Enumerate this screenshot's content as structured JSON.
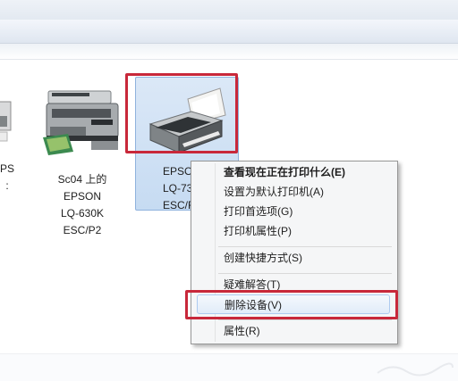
{
  "devices": [
    {
      "lines": [
        "PS",
        ":"
      ]
    },
    {
      "lines": [
        "Sc04 上的",
        "EPSON",
        "LQ-630K",
        "ESC/P2"
      ]
    },
    {
      "lines": [
        "EPSO",
        "LQ-73",
        "ESC/F"
      ]
    }
  ],
  "context_menu": {
    "items": [
      {
        "label": "查看现在正在打印什么(E)",
        "bold": true
      },
      {
        "label": "设置为默认打印机(A)"
      },
      {
        "label": "打印首选项(G)"
      },
      {
        "label": "打印机属性(P)"
      },
      {
        "label": "创建快捷方式(S)"
      },
      {
        "label": "疑难解答(T)"
      },
      {
        "label": "删除设备(V)",
        "highlighted": true
      },
      {
        "label": "属性(R)"
      }
    ]
  },
  "colors": {
    "selection": "#cde0f5",
    "annotation_red": "#c8283a",
    "menu_bg": "#f5f6f7"
  }
}
